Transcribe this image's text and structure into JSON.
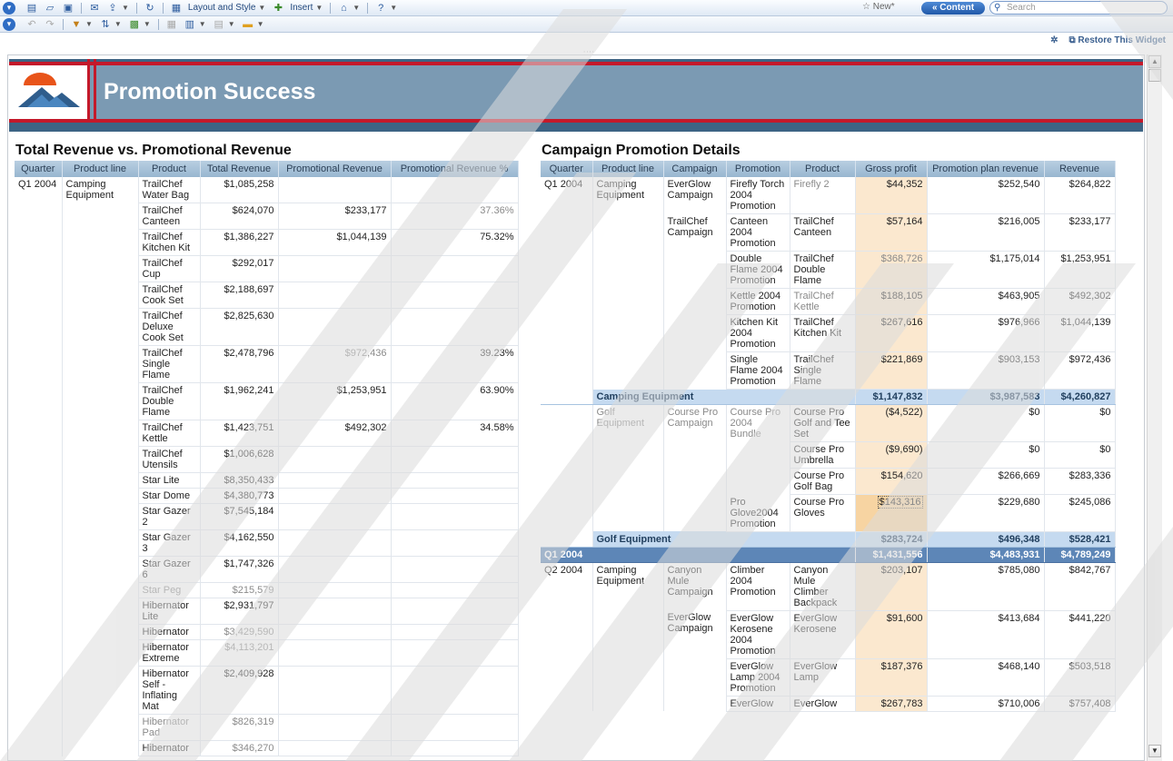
{
  "toolbar": {
    "layout_label": "Layout and Style",
    "insert_label": "Insert",
    "new_label": "New*",
    "content_label": "« Content",
    "search_placeholder": "Search",
    "restore_label": "Restore This Widget"
  },
  "banner": {
    "title": "Promotion Success"
  },
  "left_table": {
    "title": "Total Revenue vs. Promotional Revenue",
    "columns": [
      "Quarter",
      "Product line",
      "Product",
      "Total Revenue",
      "Promotional Revenue",
      "Promotional Revenue %"
    ],
    "quarter": "Q1 2004",
    "product_line": "Camping Equipment",
    "rows": [
      {
        "product": "TrailChef Water Bag",
        "total": "$1,085,258",
        "promo": "",
        "pct": ""
      },
      {
        "product": "TrailChef Canteen",
        "total": "$624,070",
        "promo": "$233,177",
        "pct": "37.36%"
      },
      {
        "product": "TrailChef Kitchen Kit",
        "total": "$1,386,227",
        "promo": "$1,044,139",
        "pct": "75.32%"
      },
      {
        "product": "TrailChef Cup",
        "total": "$292,017",
        "promo": "",
        "pct": ""
      },
      {
        "product": "TrailChef Cook Set",
        "total": "$2,188,697",
        "promo": "",
        "pct": ""
      },
      {
        "product": "TrailChef Deluxe Cook Set",
        "total": "$2,825,630",
        "promo": "",
        "pct": ""
      },
      {
        "product": "TrailChef Single Flame",
        "total": "$2,478,796",
        "promo": "$972,436",
        "pct": "39.23%"
      },
      {
        "product": "TrailChef Double Flame",
        "total": "$1,962,241",
        "promo": "$1,253,951",
        "pct": "63.90%"
      },
      {
        "product": "TrailChef Kettle",
        "total": "$1,423,751",
        "promo": "$492,302",
        "pct": "34.58%"
      },
      {
        "product": "TrailChef Utensils",
        "total": "$1,006,628",
        "promo": "",
        "pct": ""
      },
      {
        "product": "Star Lite",
        "total": "$8,350,433",
        "promo": "",
        "pct": ""
      },
      {
        "product": "Star Dome",
        "total": "$4,380,773",
        "promo": "",
        "pct": ""
      },
      {
        "product": "Star Gazer 2",
        "total": "$7,545,184",
        "promo": "",
        "pct": ""
      },
      {
        "product": "Star Gazer 3",
        "total": "$4,162,550",
        "promo": "",
        "pct": ""
      },
      {
        "product": "Star Gazer 6",
        "total": "$1,747,326",
        "promo": "",
        "pct": ""
      },
      {
        "product": "Star Peg",
        "total": "$215,579",
        "promo": "",
        "pct": ""
      },
      {
        "product": "Hibernator Lite",
        "total": "$2,931,797",
        "promo": "",
        "pct": ""
      },
      {
        "product": "Hibernator",
        "total": "$3,429,590",
        "promo": "",
        "pct": ""
      },
      {
        "product": "Hibernator Extreme",
        "total": "$4,113,201",
        "promo": "",
        "pct": ""
      },
      {
        "product": "Hibernator Self - Inflating Mat",
        "total": "$2,409,928",
        "promo": "",
        "pct": ""
      },
      {
        "product": "Hibernator Pad",
        "total": "$826,319",
        "promo": "",
        "pct": ""
      },
      {
        "product": "Hibernator",
        "total": "$346,270",
        "promo": "",
        "pct": ""
      }
    ]
  },
  "right_table": {
    "title": "Campaign Promotion Details",
    "columns": [
      "Quarter",
      "Product line",
      "Campaign",
      "Promotion",
      "Product",
      "Gross profit",
      "Promotion plan revenue",
      "Revenue"
    ],
    "rows": [
      {
        "quarter": "Q1 2004",
        "line": "Camping Equipment",
        "campaign": "EverGlow Campaign",
        "promotion": "Firefly Torch 2004 Promotion",
        "product": "Firefly 2",
        "gp": "$44,352",
        "plan": "$252,540",
        "rev": "$264,822"
      },
      {
        "quarter": "",
        "line": "",
        "campaign": "TrailChef Campaign",
        "promotion": "Canteen 2004 Promotion",
        "product": "TrailChef Canteen",
        "gp": "$57,164",
        "plan": "$216,005",
        "rev": "$233,177"
      },
      {
        "quarter": "",
        "line": "",
        "campaign": "",
        "promotion": "Double Flame 2004 Promotion",
        "product": "TrailChef Double Flame",
        "gp": "$368,726",
        "plan": "$1,175,014",
        "rev": "$1,253,951"
      },
      {
        "quarter": "",
        "line": "",
        "campaign": "",
        "promotion": "Kettle 2004 Promotion",
        "product": "TrailChef Kettle",
        "gp": "$188,105",
        "plan": "$463,905",
        "rev": "$492,302"
      },
      {
        "quarter": "",
        "line": "",
        "campaign": "",
        "promotion": "Kitchen Kit 2004 Promotion",
        "product": "TrailChef Kitchen Kit",
        "gp": "$267,616",
        "plan": "$976,966",
        "rev": "$1,044,139"
      },
      {
        "quarter": "",
        "line": "",
        "campaign": "",
        "promotion": "Single Flame 2004 Promotion",
        "product": "TrailChef Single Flame",
        "gp": "$221,869",
        "plan": "$903,153",
        "rev": "$972,436"
      }
    ],
    "sub1": {
      "label": "Camping Equipment",
      "gp": "$1,147,832",
      "plan": "$3,987,583",
      "rev": "$4,260,827"
    },
    "golf_rows": [
      {
        "line": "Golf Equipment",
        "campaign": "Course Pro Campaign",
        "promotion": "Course Pro 2004 Bundle",
        "product": "Course Pro Golf and Tee Set",
        "gp": "($4,522)",
        "plan": "$0",
        "rev": "$0"
      },
      {
        "line": "",
        "campaign": "",
        "promotion": "",
        "product": "Course Pro Umbrella",
        "gp": "($9,690)",
        "plan": "$0",
        "rev": "$0"
      },
      {
        "line": "",
        "campaign": "",
        "promotion": "",
        "product": "Course Pro Golf Bag",
        "gp": "$154,620",
        "plan": "$266,669",
        "rev": "$283,336"
      },
      {
        "line": "",
        "campaign": "",
        "promotion": "Pro Glove2004 Promotion",
        "product": "Course Pro Gloves",
        "gp": "$143,316",
        "plan": "$229,680",
        "rev": "$245,086"
      }
    ],
    "sub2": {
      "label": "Golf Equipment",
      "gp": "$283,724",
      "plan": "$496,348",
      "rev": "$528,421"
    },
    "qtotal": {
      "label": "Q1 2004",
      "gp": "$1,431,556",
      "plan": "$4,483,931",
      "rev": "$4,789,249"
    },
    "q2_rows": [
      {
        "quarter": "Q2 2004",
        "line": "Camping Equipment",
        "campaign": "Canyon Mule Campaign",
        "promotion": "Climber 2004 Promotion",
        "product": "Canyon Mule Climber Backpack",
        "gp": "$203,107",
        "plan": "$785,080",
        "rev": "$842,767"
      },
      {
        "quarter": "",
        "line": "",
        "campaign": "EverGlow Campaign",
        "promotion": "EverGlow Kerosene 2004 Promotion",
        "product": "EverGlow Kerosene",
        "gp": "$91,600",
        "plan": "$413,684",
        "rev": "$441,220"
      },
      {
        "quarter": "",
        "line": "",
        "campaign": "",
        "promotion": "EverGlow Lamp 2004 Promotion",
        "product": "EverGlow Lamp",
        "gp": "$187,376",
        "plan": "$468,140",
        "rev": "$503,518"
      },
      {
        "quarter": "",
        "line": "",
        "campaign": "",
        "promotion": "EverGlow",
        "product": "EverGlow",
        "gp": "$267,783",
        "plan": "$710,006",
        "rev": "$757,408"
      }
    ]
  }
}
